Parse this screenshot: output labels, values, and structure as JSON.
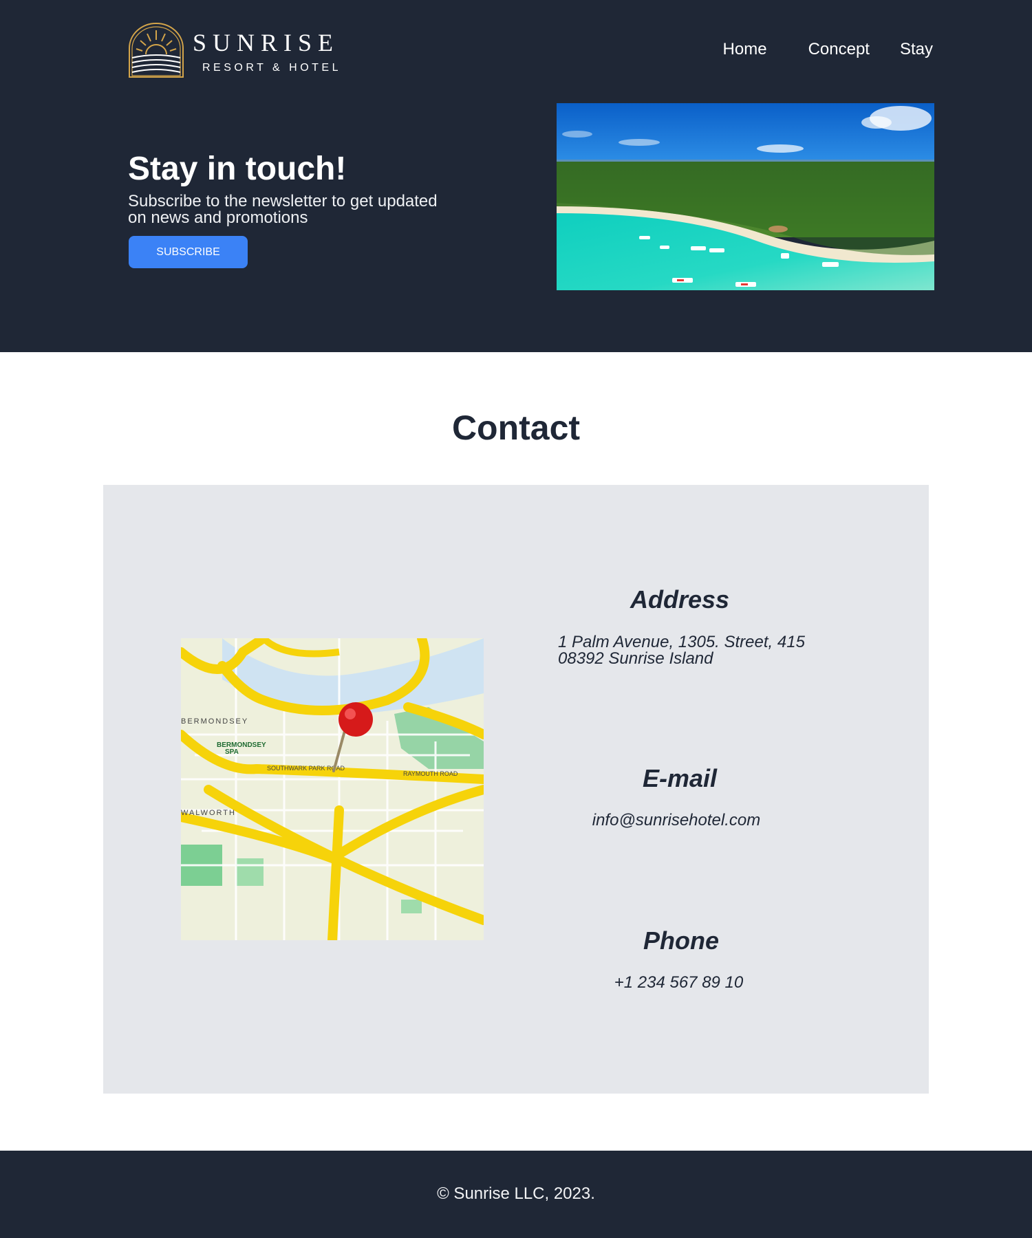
{
  "brand": {
    "name": "SUNRISE",
    "subtitle": "RESORT & HOTEL",
    "logo_icon": "sunrise-arch-icon",
    "accent_color": "#d4a54a"
  },
  "nav": {
    "items": [
      {
        "label": "Home"
      },
      {
        "label": "Concept"
      },
      {
        "label": "Stay"
      }
    ]
  },
  "hero": {
    "title": "Stay in touch!",
    "subtitle": "Subscribe to the newsletter to get updated on news and promotions",
    "button_label": "SUBSCRIBE",
    "button_color": "#3b82f6",
    "image": "aerial-tropical-beach-image"
  },
  "contact": {
    "title": "Contact",
    "map_image": "map-with-red-pin-image",
    "address": {
      "heading": "Address",
      "line1": "1 Palm Avenue, 1305. Street, 415",
      "line2": "08392 Sunrise Island"
    },
    "email": {
      "heading": "E-mail",
      "value": "info@sunrisehotel.com"
    },
    "phone": {
      "heading": "Phone",
      "value": "+1 234 567 89 10"
    }
  },
  "footer": {
    "copyright": "© Sunrise LLC, 2023."
  },
  "colors": {
    "dark_background": "#1f2736",
    "panel_background": "#e5e7eb"
  }
}
